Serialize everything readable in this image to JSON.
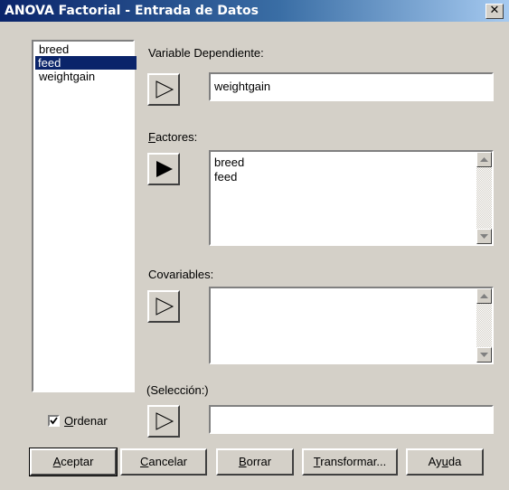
{
  "window": {
    "title": "ANOVA Factorial - Entrada de Datos",
    "close_label": "✕"
  },
  "variables": [
    {
      "name": "breed",
      "selected": false
    },
    {
      "name": "feed",
      "selected": true
    },
    {
      "name": "weightgain",
      "selected": false
    }
  ],
  "dependiente": {
    "label": "Variable Dependiente:",
    "value": "weightgain"
  },
  "factores": {
    "label_mnemonic": "F",
    "label_rest": "actores:",
    "items": [
      "breed",
      "feed"
    ]
  },
  "covariables": {
    "label": "Covariables:",
    "items": []
  },
  "seleccion": {
    "label": "(Selección:)",
    "value": ""
  },
  "ordenar": {
    "mnemonic": "O",
    "rest": "rdenar",
    "checked": true
  },
  "buttons": {
    "aceptar": {
      "m": "A",
      "rest": "ceptar"
    },
    "cancelar": {
      "m": "C",
      "rest": "ancelar"
    },
    "borrar": {
      "m": "B",
      "rest": "orrar"
    },
    "transformar": {
      "m": "T",
      "rest": "ransformar..."
    },
    "ayuda": {
      "pre": "Ay",
      "m": "u",
      "rest": "da"
    }
  }
}
